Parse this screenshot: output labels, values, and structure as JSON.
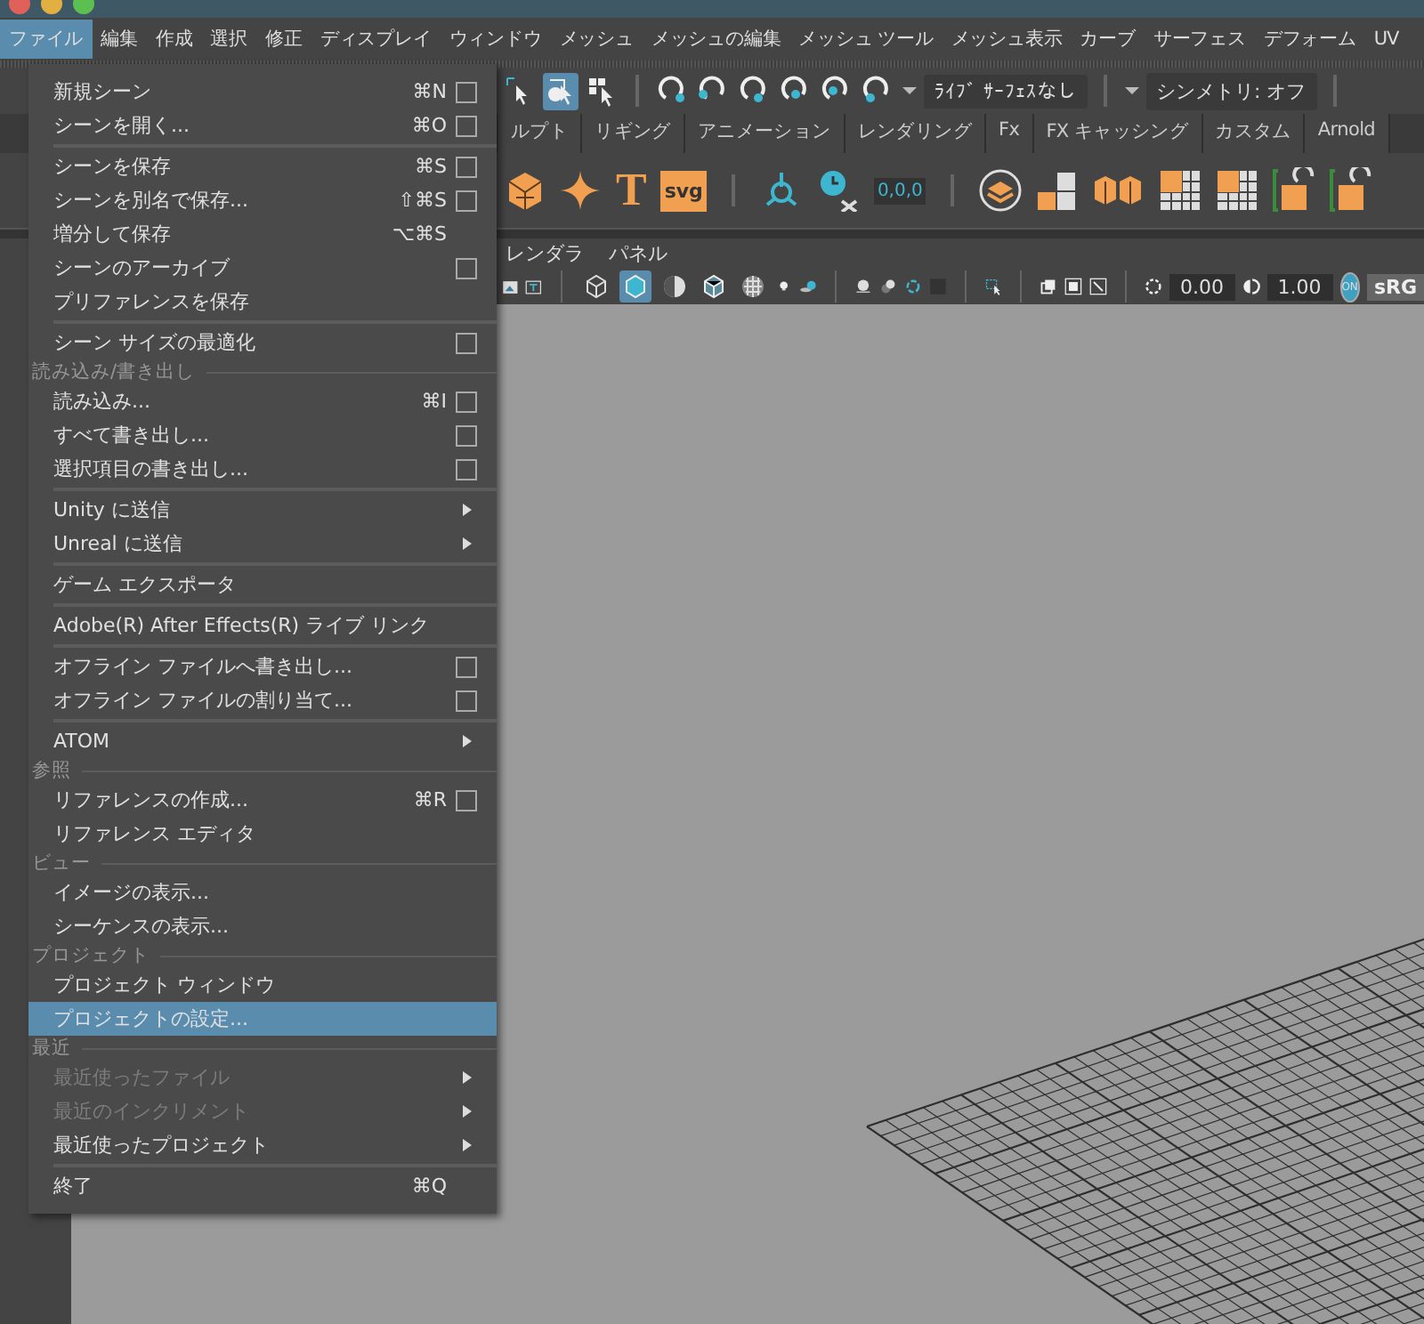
{
  "menu_bar": [
    {
      "label": "ファイル",
      "selected": true
    },
    {
      "label": "編集",
      "selected": false
    },
    {
      "label": "作成",
      "selected": false
    },
    {
      "label": "選択",
      "selected": false
    },
    {
      "label": "修正",
      "selected": false
    },
    {
      "label": "ディスプレイ",
      "selected": false
    },
    {
      "label": "ウィンドウ",
      "selected": false
    },
    {
      "label": "メッシュ",
      "selected": false
    },
    {
      "label": "メッシュの編集",
      "selected": false
    },
    {
      "label": "メッシュ ツール",
      "selected": false
    },
    {
      "label": "メッシュ表示",
      "selected": false
    },
    {
      "label": "カーブ",
      "selected": false
    },
    {
      "label": "サーフェス",
      "selected": false
    },
    {
      "label": "デフォーム",
      "selected": false
    },
    {
      "label": "UV",
      "selected": false
    }
  ],
  "tool_row": {
    "tools": [
      {
        "kind": "select",
        "selected": false
      },
      {
        "kind": "lasso",
        "selected": true
      },
      {
        "kind": "paint",
        "selected": false
      }
    ],
    "live_surface": "ﾗｲﾌﾞ ｻｰﾌｪｽなし",
    "symmetry": "シンメトリ: オフ"
  },
  "shelf_tabs": [
    {
      "label": "ルプト",
      "selected": false
    },
    {
      "label": "リギング",
      "selected": false
    },
    {
      "label": "アニメーション",
      "selected": false
    },
    {
      "label": "レンダリング",
      "selected": false
    },
    {
      "label": "Fx",
      "selected": false
    },
    {
      "label": "FX キャッシング",
      "selected": false
    },
    {
      "label": "カスタム",
      "selected": false
    },
    {
      "label": "Arnold",
      "selected": false
    }
  ],
  "shelf": [
    {
      "kind": "polyhedron"
    },
    {
      "kind": "sparkle"
    },
    {
      "kind": "type",
      "label": "T"
    },
    {
      "kind": "svg",
      "label": "svg"
    },
    {
      "kind": "sep"
    },
    {
      "kind": "locator"
    },
    {
      "kind": "clock"
    },
    {
      "kind": "coords",
      "label": "0,0,0"
    },
    {
      "kind": "sep"
    },
    {
      "kind": "disc"
    },
    {
      "kind": "tiles"
    },
    {
      "kind": "cubes"
    },
    {
      "kind": "grid"
    },
    {
      "kind": "grid"
    },
    {
      "kind": "bracket"
    },
    {
      "kind": "bracket"
    }
  ],
  "panel_menu": [
    "レンダラ",
    "パネル"
  ],
  "panel_toolbar": {
    "shading": [
      {
        "kind": "wireframe",
        "selected": false
      },
      {
        "kind": "shaded",
        "selected": true
      },
      {
        "kind": "half",
        "selected": false
      },
      {
        "kind": "wire-on-shaded",
        "selected": false
      },
      {
        "kind": "checker",
        "selected": false
      }
    ],
    "exposure": "0.00",
    "gamma": "1.00",
    "color_management": {
      "label": "ON",
      "on": true
    },
    "view_transform": "sRG"
  },
  "file_menu": {
    "items": [
      {
        "kind": "item",
        "label": "新規シーン",
        "shortcut": "⌘N",
        "option_box": true,
        "submenu": false,
        "disabled": false,
        "selected": false
      },
      {
        "kind": "item",
        "label": "シーンを開く...",
        "shortcut": "⌘O",
        "option_box": true,
        "submenu": false,
        "disabled": false,
        "selected": false
      },
      {
        "kind": "separator"
      },
      {
        "kind": "item",
        "label": "シーンを保存",
        "shortcut": "⌘S",
        "option_box": true,
        "submenu": false,
        "disabled": false,
        "selected": false
      },
      {
        "kind": "item",
        "label": "シーンを別名で保存...",
        "shortcut": "⇧⌘S",
        "option_box": true,
        "submenu": false,
        "disabled": false,
        "selected": false
      },
      {
        "kind": "item",
        "label": "増分して保存",
        "shortcut": "⌥⌘S",
        "option_box": false,
        "submenu": false,
        "disabled": false,
        "selected": false
      },
      {
        "kind": "item",
        "label": "シーンのアーカイブ",
        "option_box": true,
        "submenu": false,
        "disabled": false,
        "selected": false
      },
      {
        "kind": "item",
        "label": "プリファレンスを保存",
        "option_box": false,
        "submenu": false,
        "disabled": false,
        "selected": false
      },
      {
        "kind": "separator"
      },
      {
        "kind": "item",
        "label": "シーン サイズの最適化",
        "option_box": true,
        "submenu": false,
        "disabled": false,
        "selected": false
      },
      {
        "kind": "section",
        "label": "読み込み/書き出し"
      },
      {
        "kind": "item",
        "label": "読み込み...",
        "shortcut": "⌘I",
        "option_box": true,
        "submenu": false,
        "disabled": false,
        "selected": false
      },
      {
        "kind": "item",
        "label": "すべて書き出し...",
        "option_box": true,
        "submenu": false,
        "disabled": false,
        "selected": false
      },
      {
        "kind": "item",
        "label": "選択項目の書き出し...",
        "option_box": true,
        "submenu": false,
        "disabled": false,
        "selected": false
      },
      {
        "kind": "separator"
      },
      {
        "kind": "item",
        "label": "Unity に送信",
        "option_box": false,
        "submenu": true,
        "disabled": false,
        "selected": false
      },
      {
        "kind": "item",
        "label": "Unreal に送信",
        "option_box": false,
        "submenu": true,
        "disabled": false,
        "selected": false
      },
      {
        "kind": "separator"
      },
      {
        "kind": "item",
        "label": "ゲーム エクスポータ",
        "option_box": false,
        "submenu": false,
        "disabled": false,
        "selected": false
      },
      {
        "kind": "separator"
      },
      {
        "kind": "item",
        "label": "Adobe(R) After Effects(R) ライブ リンク",
        "option_box": false,
        "submenu": false,
        "disabled": false,
        "selected": false
      },
      {
        "kind": "separator"
      },
      {
        "kind": "item",
        "label": "オフライン ファイルへ書き出し...",
        "option_box": true,
        "submenu": false,
        "disabled": false,
        "selected": false
      },
      {
        "kind": "item",
        "label": "オフライン ファイルの割り当て...",
        "option_box": true,
        "submenu": false,
        "disabled": false,
        "selected": false
      },
      {
        "kind": "separator"
      },
      {
        "kind": "item",
        "label": "ATOM",
        "option_box": false,
        "submenu": true,
        "disabled": false,
        "selected": false
      },
      {
        "kind": "section",
        "label": "参照"
      },
      {
        "kind": "item",
        "label": "リファレンスの作成...",
        "shortcut": "⌘R",
        "option_box": true,
        "submenu": false,
        "disabled": false,
        "selected": false
      },
      {
        "kind": "item",
        "label": "リファレンス エディタ",
        "option_box": false,
        "submenu": false,
        "disabled": false,
        "selected": false
      },
      {
        "kind": "section",
        "label": "ビュー"
      },
      {
        "kind": "item",
        "label": "イメージの表示...",
        "option_box": false,
        "submenu": false,
        "disabled": false,
        "selected": false
      },
      {
        "kind": "item",
        "label": "シーケンスの表示...",
        "option_box": false,
        "submenu": false,
        "disabled": false,
        "selected": false
      },
      {
        "kind": "section",
        "label": "プロジェクト"
      },
      {
        "kind": "item",
        "label": "プロジェクト ウィンドウ",
        "option_box": false,
        "submenu": false,
        "disabled": false,
        "selected": false
      },
      {
        "kind": "item",
        "label": "プロジェクトの設定...",
        "option_box": false,
        "submenu": false,
        "disabled": false,
        "selected": true
      },
      {
        "kind": "section",
        "label": "最近"
      },
      {
        "kind": "item",
        "label": "最近使ったファイル",
        "option_box": false,
        "submenu": true,
        "disabled": true,
        "selected": false
      },
      {
        "kind": "item",
        "label": "最近のインクリメント",
        "option_box": false,
        "submenu": true,
        "disabled": true,
        "selected": false
      },
      {
        "kind": "item",
        "label": "最近使ったプロジェクト",
        "option_box": false,
        "submenu": true,
        "disabled": false,
        "selected": false
      },
      {
        "kind": "separator"
      },
      {
        "kind": "item",
        "label": "終了",
        "shortcut": "⌘Q",
        "option_box": false,
        "submenu": false,
        "disabled": false,
        "selected": false
      }
    ]
  }
}
